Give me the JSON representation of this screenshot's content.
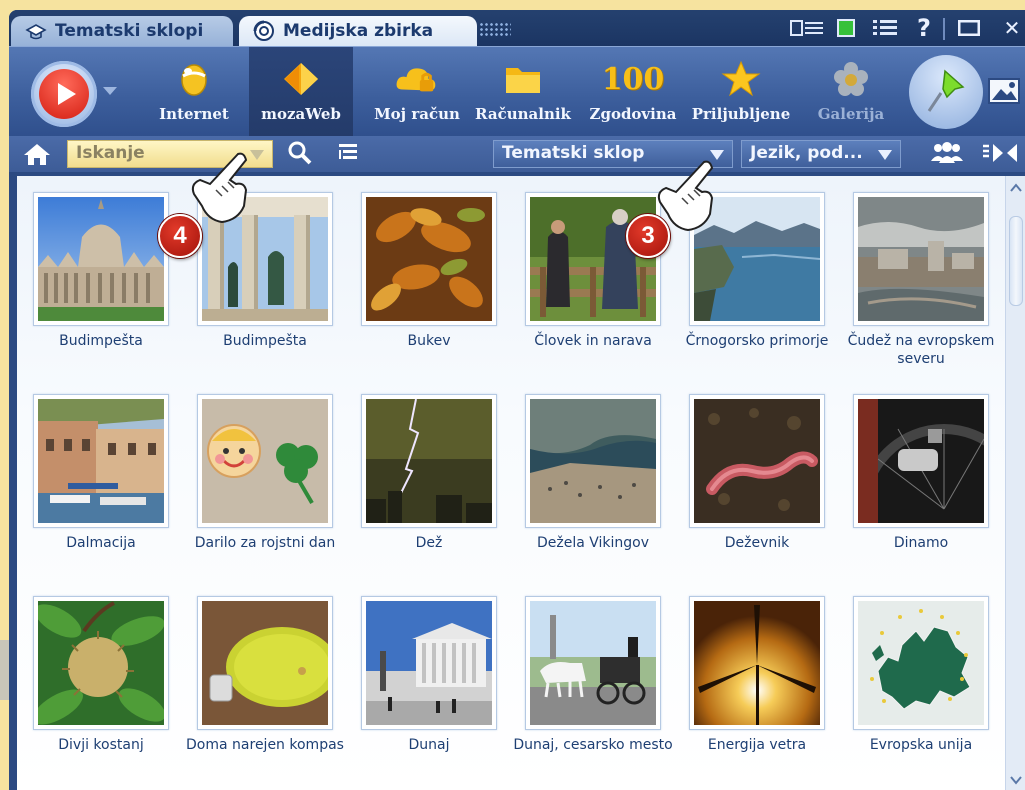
{
  "tabs": {
    "tab1": "Tematski sklopi",
    "tab2": "Medijska zbirka"
  },
  "toolbar": {
    "internet": "Internet",
    "mozaweb": "mozaWeb",
    "moj_racun": "Moj račun",
    "racunalnik": "Računalnik",
    "zgodovina": "Zgodovina",
    "zgodovina_icon_text": "100",
    "priljubljene": "Priljubljene",
    "galerija": "Galerija"
  },
  "search": {
    "placeholder": "Iskanje",
    "theme_dropdown": "Tematski sklop",
    "lang_dropdown": "Jezik, pod..."
  },
  "window_controls": {
    "help": "?",
    "close": "✕"
  },
  "tiles": [
    {
      "caption": "Budimpešta"
    },
    {
      "caption": "Budimpešta"
    },
    {
      "caption": "Bukev"
    },
    {
      "caption": "Človek in narava"
    },
    {
      "caption": "Črnogorsko primorje"
    },
    {
      "caption": "Čudež na evropskem severu"
    },
    {
      "caption": "Dalmacija"
    },
    {
      "caption": "Darilo za rojstni dan"
    },
    {
      "caption": "Dež"
    },
    {
      "caption": "Dežela Vikingov"
    },
    {
      "caption": "Deževnik"
    },
    {
      "caption": "Dinamo"
    },
    {
      "caption": "Divji kostanj"
    },
    {
      "caption": "Doma narejen kompas"
    },
    {
      "caption": "Dunaj"
    },
    {
      "caption": "Dunaj, cesarsko mesto"
    },
    {
      "caption": "Energija vetra"
    },
    {
      "caption": "Evropska unija"
    }
  ],
  "callouts": {
    "a": "4",
    "b": "3"
  },
  "colors": {
    "window_blue": "#2c4a82",
    "accent_red": "#d41e12",
    "search_yellow": "#f1dd8e",
    "caption_text": "#1e3f73"
  }
}
